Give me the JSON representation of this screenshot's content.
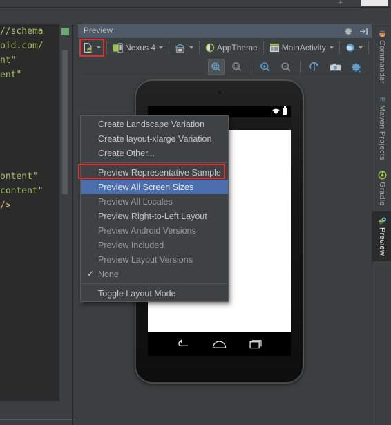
{
  "window": {
    "top_plus": "+"
  },
  "editor": {
    "lines": [
      "//schema",
      "oid.com/",
      "nt\"",
      "ent\"",
      "",
      "",
      "",
      "",
      "",
      "",
      "ontent\"",
      "content\"",
      "/>"
    ]
  },
  "preview": {
    "title": "Preview",
    "header_icons": [
      {
        "name": "settings-gear-icon",
        "glyph": "gear"
      },
      {
        "name": "hide-panel-icon",
        "glyph": "hide"
      }
    ],
    "toolbar": {
      "config_button_label": "",
      "device_label": "Nexus 4",
      "orientation_label": "",
      "theme_label": "AppTheme",
      "activity_label": "MainActivity",
      "locale_label": "",
      "more_label": "»"
    },
    "actions": [
      {
        "name": "zoom-to-fit-button",
        "label": "Zoom to Fit",
        "selected": true
      },
      {
        "name": "zoom-actual-size-button",
        "label": "1:1",
        "selected": false
      },
      {
        "name": "zoom-in-button",
        "label": "Zoom In",
        "selected": false
      },
      {
        "name": "zoom-out-button",
        "label": "Zoom Out",
        "selected": false
      },
      {
        "name": "refresh-button",
        "label": "Refresh",
        "selected": false
      },
      {
        "name": "screenshot-button",
        "label": "Screenshot",
        "selected": false
      },
      {
        "name": "preview-settings-button",
        "label": "Settings",
        "selected": false
      }
    ]
  },
  "menu": {
    "items": [
      {
        "label": "Create Landscape Variation",
        "state": "normal",
        "checked": false,
        "separator_after": false
      },
      {
        "label": "Create layout-xlarge Variation",
        "state": "normal",
        "checked": false,
        "separator_after": false
      },
      {
        "label": "Create Other...",
        "state": "normal",
        "checked": false,
        "separator_after": true
      },
      {
        "label": "Preview Representative Sample",
        "state": "normal",
        "checked": false,
        "separator_after": false
      },
      {
        "label": "Preview All Screen Sizes",
        "state": "selected",
        "checked": false,
        "separator_after": false
      },
      {
        "label": "Preview All Locales",
        "state": "disabled",
        "checked": false,
        "separator_after": false
      },
      {
        "label": "Preview Right-to-Left Layout",
        "state": "normal",
        "checked": false,
        "separator_after": false
      },
      {
        "label": "Preview Android Versions",
        "state": "disabled",
        "checked": false,
        "separator_after": false
      },
      {
        "label": "Preview Included",
        "state": "disabled",
        "checked": false,
        "separator_after": false
      },
      {
        "label": "Preview Layout Versions",
        "state": "disabled",
        "checked": false,
        "separator_after": false
      },
      {
        "label": "None",
        "state": "disabled",
        "checked": true,
        "separator_after": true
      },
      {
        "label": "Toggle Layout Mode",
        "state": "normal",
        "checked": false,
        "separator_after": false
      }
    ],
    "check_glyph": "✓"
  },
  "device_preview": {
    "device_name": "Nexus 4",
    "status_bar_icons": [
      "wifi-icon",
      "battery-icon"
    ],
    "nav_buttons": [
      "back-button",
      "home-button",
      "recents-button"
    ]
  },
  "right_sidebar": {
    "items": [
      {
        "label": "Commander",
        "icon": "commander-icon",
        "active": false
      },
      {
        "label": "Maven Projects",
        "icon": "maven-icon",
        "active": false
      },
      {
        "label": "Gradle",
        "icon": "gradle-icon",
        "active": false
      },
      {
        "label": "Preview",
        "icon": "preview-icon",
        "active": true
      }
    ]
  },
  "colors": {
    "panel_bg": "#3c3f41",
    "editor_bg": "#2b2b2b",
    "menu_bg": "#3f4244",
    "menu_selection": "#4b6eaf",
    "annotation_red": "#e33030",
    "header_bg": "#4e5a68",
    "code_string": "#a5c261",
    "accent_blue": "#5f9fd0"
  }
}
